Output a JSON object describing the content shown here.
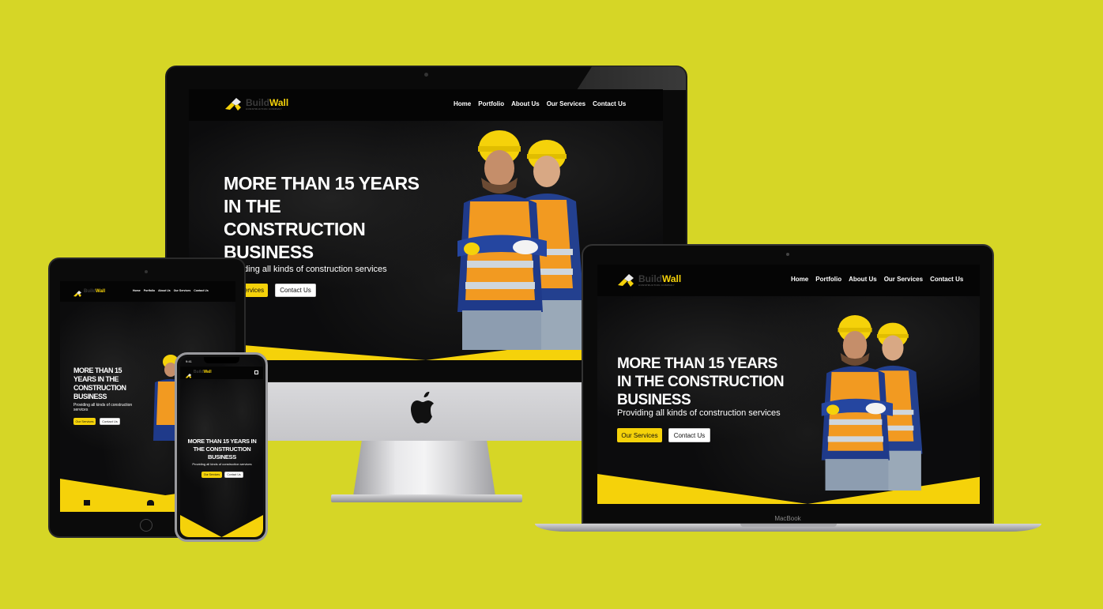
{
  "brand": {
    "name_part1": "Build",
    "name_part2": "Wall",
    "tagline": "CONSTRUCTION COMPANY"
  },
  "nav": [
    "Home",
    "Portfolio",
    "About Us",
    "Our Services",
    "Contact Us"
  ],
  "hero": {
    "title": "MORE THAN 15 YEARS IN THE CONSTRUCTION BUSINESS",
    "subtitle": "Providing all kinds of construction services",
    "primary_button": "Our Services",
    "secondary_button": "Contact Us"
  },
  "devices": {
    "laptop_label": "MacBook",
    "phone_time": "9:41"
  },
  "colors": {
    "background": "#d6d626",
    "accent": "#f5d20a",
    "site_dark": "#0c0c0d"
  }
}
